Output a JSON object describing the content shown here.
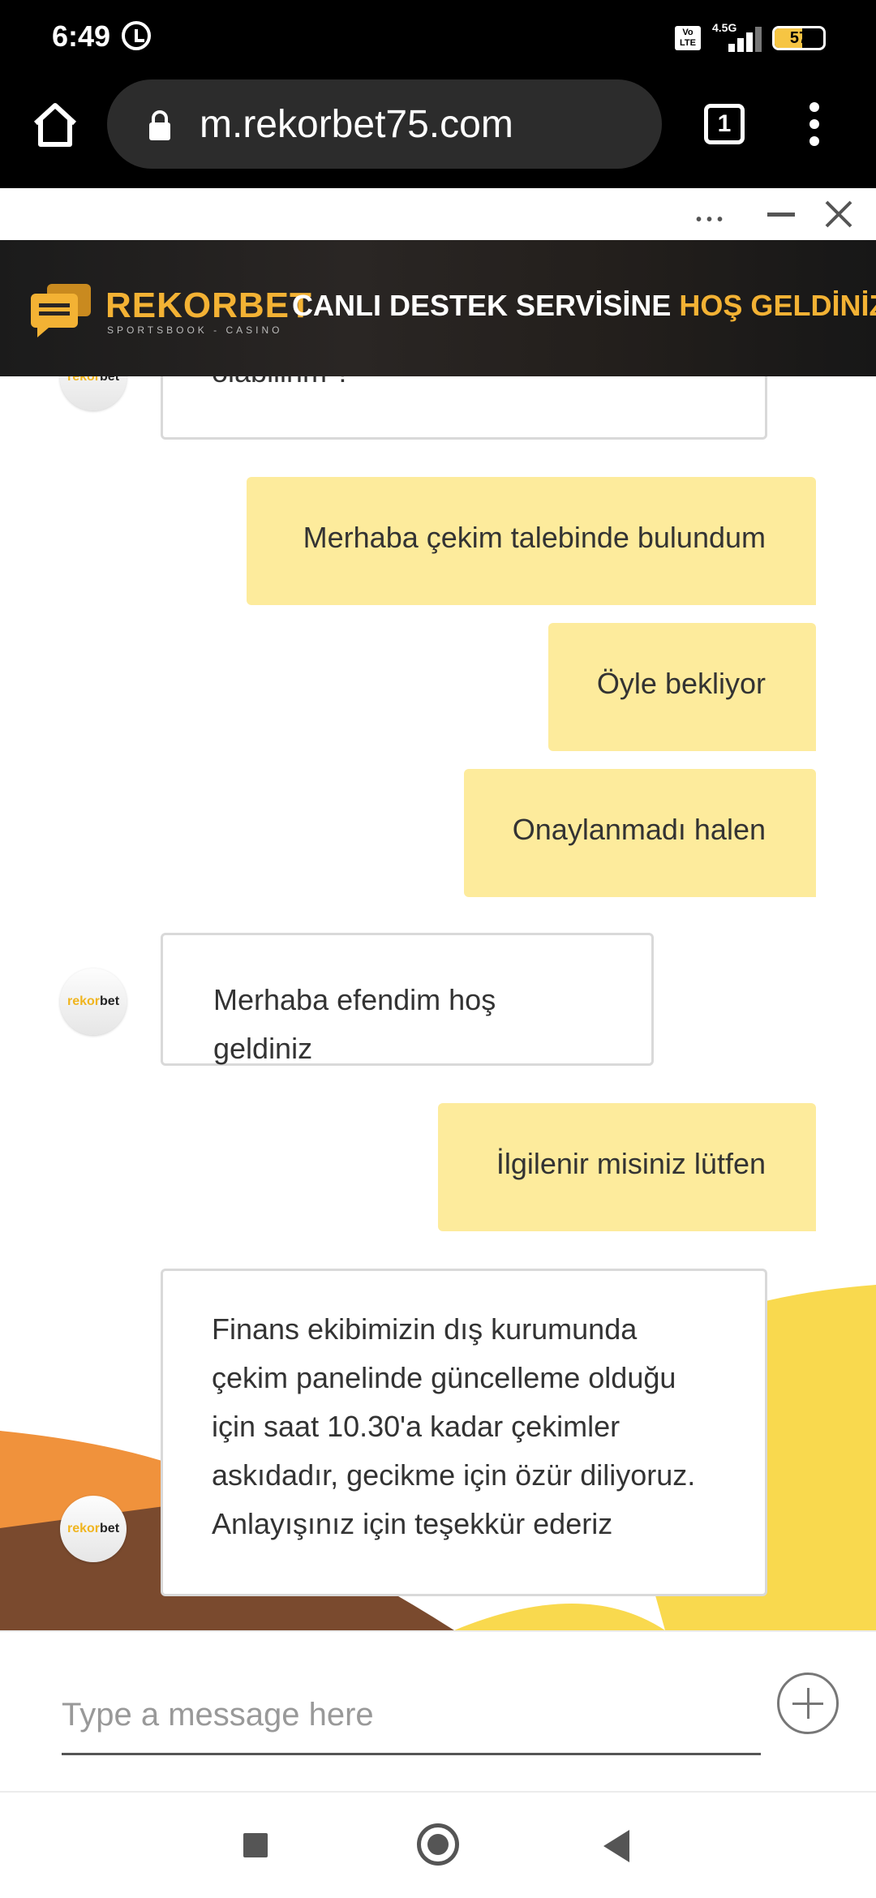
{
  "status_bar": {
    "time": "6:49",
    "volte": "Vo LTE",
    "network": "4.5G",
    "battery": "57",
    "battery_level": 0.57
  },
  "browser": {
    "url": "m.rekorbet75.com",
    "tab_count": "1"
  },
  "widget": {
    "more_icon": "more-dots-icon",
    "minimize_icon": "minimize-icon",
    "close_icon": "close-icon"
  },
  "banner": {
    "brand": "REKORBET",
    "brand_sub": "SPORTSBOOK - CASINO",
    "headline_main": "CANLI DESTEK SERVİSİNE ",
    "headline_accent": "HOŞ GELDİNİZ",
    "accent_color": "#f3b234"
  },
  "avatar": {
    "brand_part1": "rekor",
    "brand_part2": "bet"
  },
  "messages": [
    {
      "from": "agent",
      "text": "olabilirim ?"
    },
    {
      "from": "user",
      "text": "Merhaba çekim talebinde bulundum"
    },
    {
      "from": "user",
      "text": "Öyle bekliyor"
    },
    {
      "from": "user",
      "text": "Onaylanmadı halen"
    },
    {
      "from": "agent",
      "text": "Merhaba efendim hoş geldiniz"
    },
    {
      "from": "user",
      "text": "İlgilenir misiniz lütfen"
    },
    {
      "from": "agent",
      "lines": [
        "Finans ekibimizin dış kurumunda",
        "çekim panelinde güncelleme olduğu",
        "için saat 10.30'a kadar çekimler",
        "askıdadır, gecikme için özür diliyoruz.",
        "Anlayışınız için teşekkür ederiz"
      ]
    }
  ],
  "composer": {
    "placeholder": "Type a message here"
  },
  "colors": {
    "user_bubble": "#fdeb9c",
    "decor_orange": "#f0923c",
    "decor_brown": "#7a4a2e",
    "decor_yellow": "#f9d94e"
  }
}
